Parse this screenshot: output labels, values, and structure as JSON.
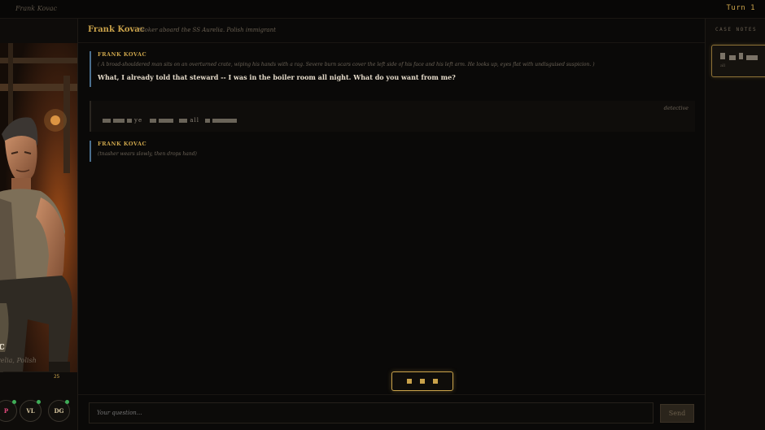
{
  "app": {
    "title": "Frank Kovac",
    "turn": "Turn 1"
  },
  "left_panel": {
    "name": "c",
    "subtitle": "S Aurelia, Polish",
    "meter_value": "25",
    "stats": [
      {
        "label": "P",
        "color": "#e0487b"
      },
      {
        "label": "VL",
        "color": "#d8c7a0"
      },
      {
        "label": "DG",
        "color": "#d8c7a0"
      }
    ]
  },
  "chat": {
    "header": {
      "name": "Frank Kovac",
      "description": "Stoker aboard the SS Aurelia. Polish immigrant"
    },
    "messages": [
      {
        "speaker": "FRANK KOVAC",
        "action": "( A broad-shouldered man sits on an overturned crate, wiping his hands with a rag. Severe burn scars cover the left side of his face and his left arm. He looks up, eyes flat with undisguised suspicion. )",
        "line": "What, I already told that steward -- I was in the boiler room all night. What do you want from me?"
      },
      {
        "who": "detective",
        "fragment1": "ye",
        "fragment2": "all"
      },
      {
        "speaker": "FRANK KOVAC",
        "action": "(tnasher wears slowly, then drops hand)"
      }
    ],
    "input_placeholder": "Your question...",
    "send_label": "Send"
  },
  "notes": {
    "heading": "CASE NOTES",
    "small": "all"
  },
  "colors": {
    "accent": "#c9a24a",
    "npc_border": "#4b6f8f",
    "online": "#3fae58"
  }
}
